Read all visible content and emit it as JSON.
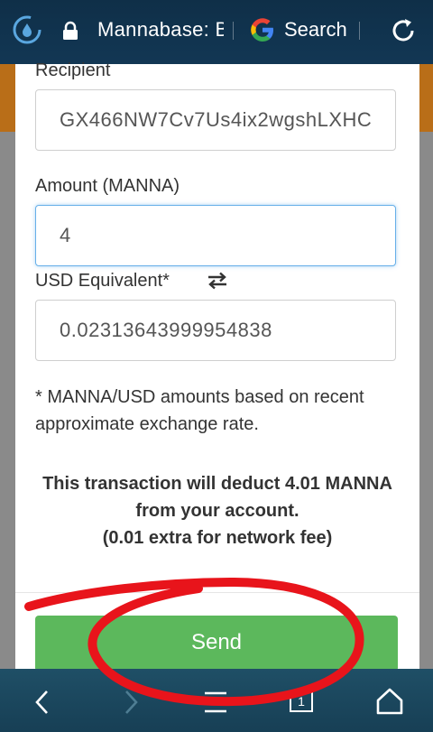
{
  "browser": {
    "url_label": "Mannabase: B",
    "search_label": "Search",
    "icons": {
      "shield": "shield-icon",
      "lock": "lock-icon",
      "google": "google-icon",
      "reload": "reload-icon"
    }
  },
  "form": {
    "recipient_label": "Recipient",
    "recipient_value": "GX466NW7Cv7Us4ix2wgshLXHC",
    "amount_label": "Amount (MANNA)",
    "amount_value": "4",
    "usd_label": "USD Equivalent*",
    "usd_value": "0.02313643999954838",
    "note": "* MANNA/USD amounts based on recent approximate exchange rate.",
    "deduct_line1": "This transaction will deduct 4.01 MANNA",
    "deduct_line2": "from your account.",
    "deduct_line3": "(0.01 extra for network fee)",
    "send_label": "Send"
  },
  "navbar": {
    "tabs_count": "1"
  },
  "colors": {
    "send_button": "#5cb85c",
    "annotation": "#e8141b",
    "focus_border": "#66afe9"
  }
}
